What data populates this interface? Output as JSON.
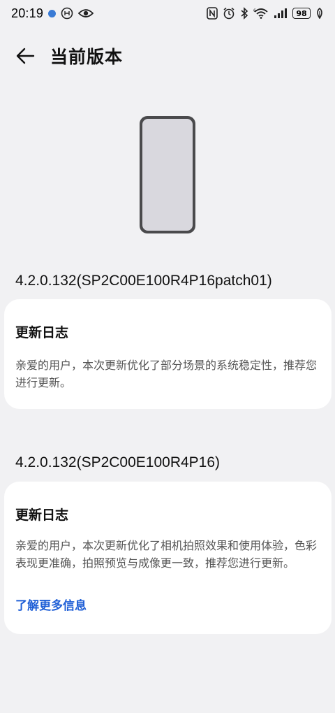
{
  "status_bar": {
    "time": "20:19",
    "battery": "98",
    "icons": [
      "app-notification-dot-icon",
      "dnd-icon",
      "eye-comfort-icon",
      "nfc-icon",
      "alarm-icon",
      "bluetooth-icon",
      "wifi-6-icon",
      "signal-icon",
      "battery-icon",
      "charging-leaf-icon"
    ]
  },
  "header": {
    "title": "当前版本",
    "back_icon": "back-arrow-icon"
  },
  "illustration": {
    "icon": "phone-outline-icon"
  },
  "versions": [
    {
      "version": "4.2.0.132(SP2C00E100R4P16patch01)",
      "log_title": "更新日志",
      "log_text": "亲爱的用户，本次更新优化了部分场景的系统稳定性，推荐您进行更新。"
    },
    {
      "version": "4.2.0.132(SP2C00E100R4P16)",
      "log_title": "更新日志",
      "log_text": "亲爱的用户，本次更新优化了相机拍照效果和使用体验，色彩表现更准确，拍照预览与成像更一致，推荐您进行更新。",
      "link": "了解更多信息"
    }
  ],
  "colors": {
    "background": "#f1f1f3",
    "card": "#ffffff",
    "link": "#1f5fd6",
    "body_text": "#555555"
  }
}
